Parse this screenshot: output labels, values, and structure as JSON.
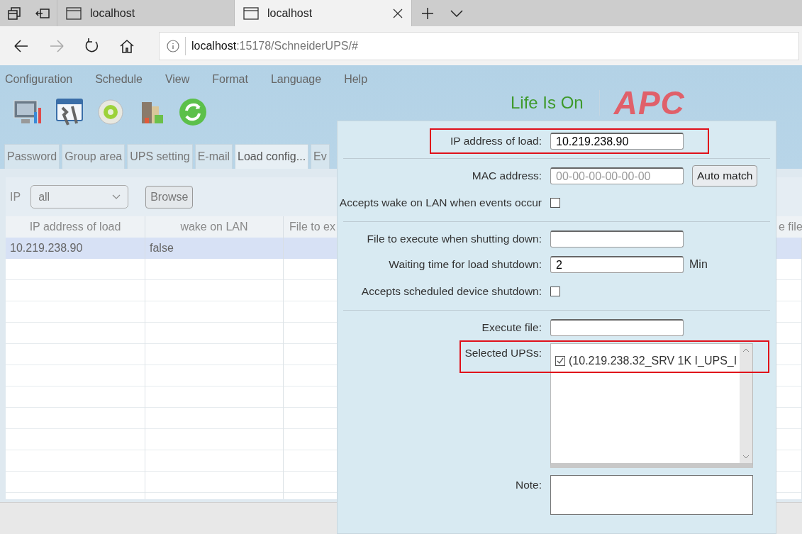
{
  "browser": {
    "tabs": [
      {
        "title": "localhost",
        "selected": false
      },
      {
        "title": "localhost",
        "selected": true
      }
    ],
    "address": {
      "host": "localhost",
      "path": ":15178/SchneiderUPS/#"
    }
  },
  "menu": [
    "Configuration",
    "Schedule",
    "View",
    "Format",
    "Language",
    "Help"
  ],
  "brand": {
    "tagline": "Life Is On",
    "name": "APC"
  },
  "tabs": [
    {
      "label": "Password",
      "selected": false
    },
    {
      "label": "Group area",
      "selected": false
    },
    {
      "label": "UPS setting",
      "selected": false
    },
    {
      "label": "E-mail",
      "selected": false
    },
    {
      "label": "Load config...",
      "selected": true
    },
    {
      "label": "Ev",
      "selected": false
    }
  ],
  "filter": {
    "label": "IP",
    "value": "all",
    "button": "Browse"
  },
  "table": {
    "columns": [
      "IP address of load",
      "wake on LAN",
      "File to ex",
      "e file"
    ],
    "rows": [
      {
        "cells": [
          "10.219.238.90",
          "false"
        ],
        "selected": true
      }
    ]
  },
  "dialog": {
    "sections": [
      [
        {
          "kind": "text",
          "label": "IP address of load:",
          "value": "10.219.238.90",
          "highlighted": true
        }
      ],
      [
        {
          "kind": "text",
          "label": "MAC address:",
          "placeholder": "00-00-00-00-00-00",
          "button": "Auto match",
          "highlighted": false
        },
        {
          "kind": "checkbox",
          "label": "Accepts wake on LAN when events occur",
          "checked": false,
          "highlighted": false
        }
      ],
      [
        {
          "kind": "text",
          "label": "File to execute when shutting down:",
          "highlighted": false
        },
        {
          "kind": "text",
          "label": "Waiting time for load shutdown:",
          "value": "2",
          "unit": "Min",
          "highlighted": false
        },
        {
          "kind": "checkbox",
          "label": "Accepts scheduled device shutdown:",
          "checked": false,
          "highlighted": false
        }
      ],
      [
        {
          "kind": "text",
          "label": "Execute file:",
          "highlighted": false
        },
        {
          "kind": "list",
          "label": "Selected UPSs:",
          "highlighted": true,
          "items": [
            {
              "label": "(10.219.238.32_SRV 1K I_UPS_I",
              "checked": true
            }
          ]
        },
        {
          "kind": "textarea",
          "label": "Note:",
          "highlighted": false
        }
      ]
    ]
  }
}
